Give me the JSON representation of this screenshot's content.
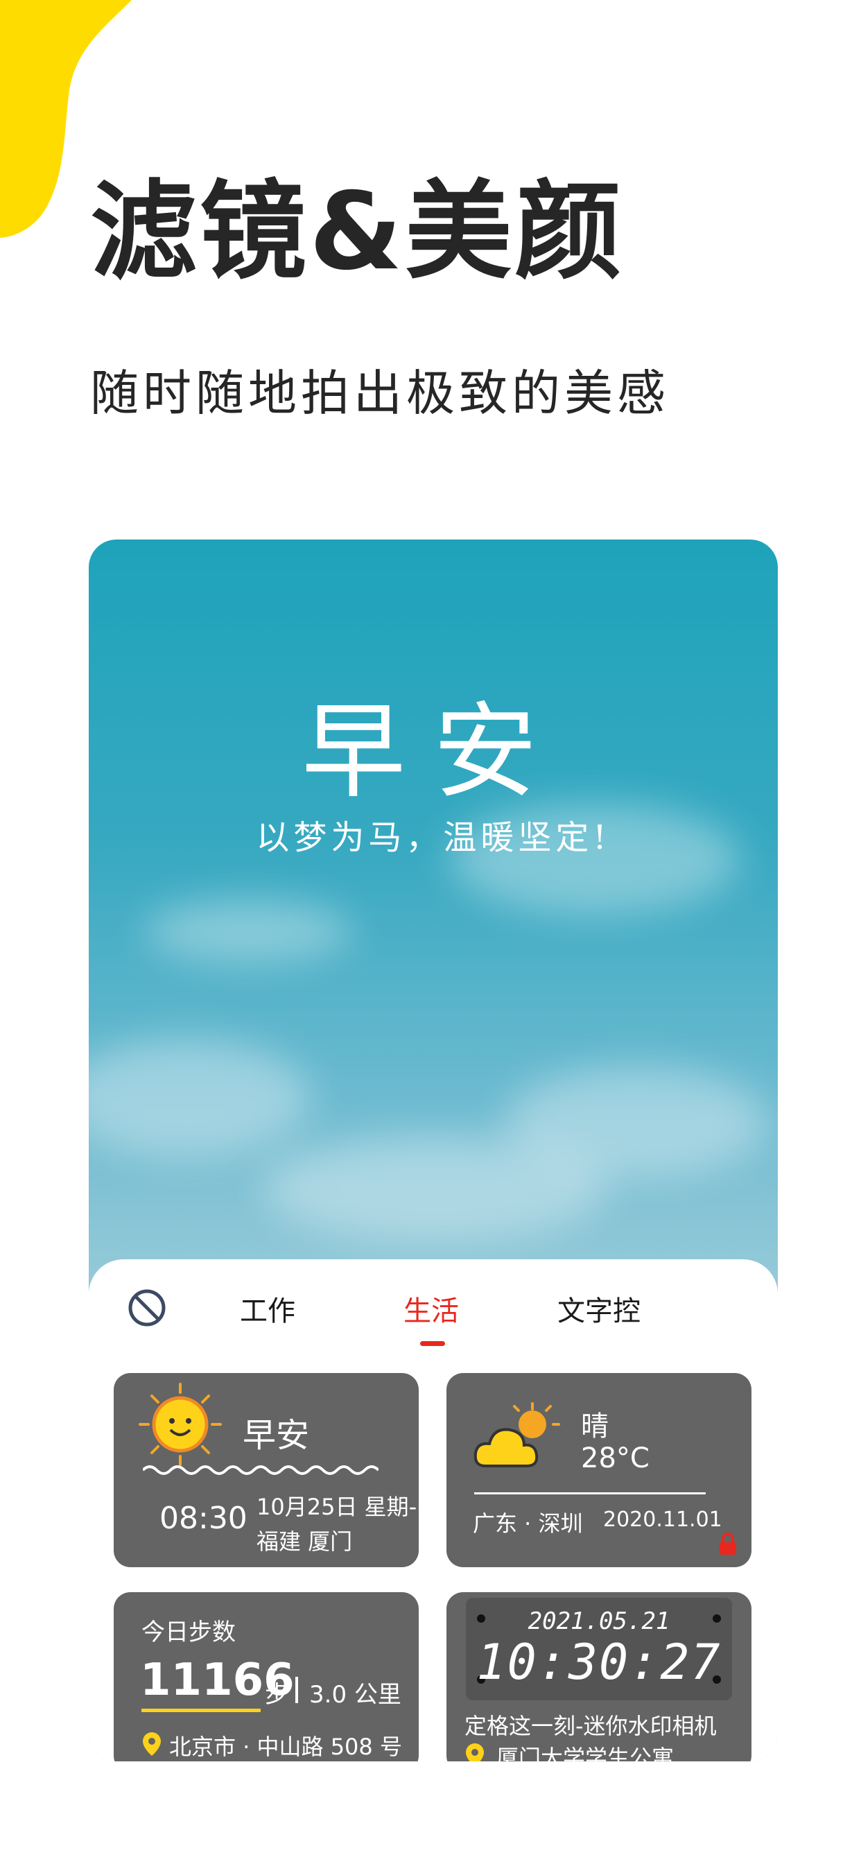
{
  "headline": "滤镜&美颜",
  "subheadline": "随时随地拍出极致的美感",
  "preview": {
    "greeting": "早安",
    "motto": "以梦为马，温暖坚定!"
  },
  "tabs": [
    {
      "label": "工作"
    },
    {
      "label": "生活"
    },
    {
      "label": "文字控"
    }
  ],
  "active_tab": "生活",
  "cards": {
    "morning": {
      "title": "早安",
      "time": "08:30",
      "date": "10月25日 星期-",
      "location": "福建 厦门"
    },
    "weather": {
      "condition": "晴",
      "temperature": "28°C",
      "location": "广东 · 深圳",
      "date": "2020.11.01"
    },
    "steps": {
      "label": "今日步数",
      "count": "11166",
      "unit": "步",
      "distance": "3.0 公里",
      "address": "北京市 · 中山路 508 号"
    },
    "clock": {
      "date": "2021.05.21",
      "time": "10:30:27",
      "caption": "定格这一刻-迷你水印相机",
      "address": "厦门大学学生公寓"
    }
  },
  "colors": {
    "accent": "#e8281f",
    "brand_yellow": "#ffd800",
    "card_bg": "#646464",
    "step_underline": "#ffd21a"
  }
}
